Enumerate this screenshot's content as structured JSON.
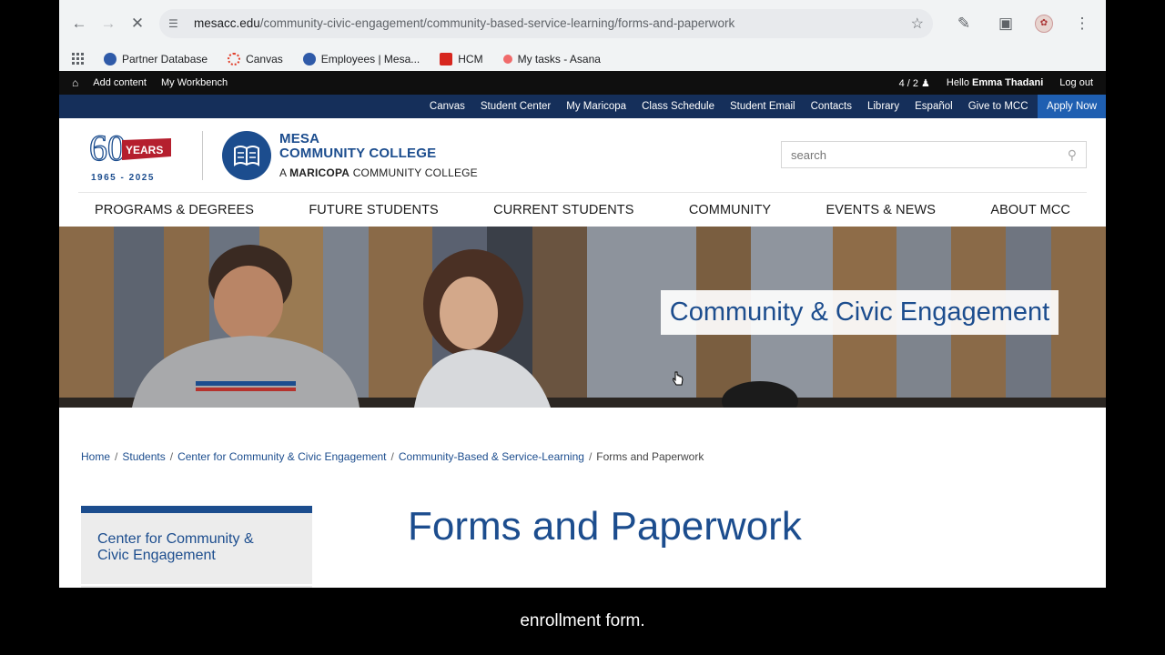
{
  "browser": {
    "url_domain": "mesacc.edu",
    "url_path": "/community-civic-engagement/community-based-service-learning/forms-and-paperwork"
  },
  "bookmarks": [
    {
      "label": "Partner Database",
      "color": "#2f5aa8"
    },
    {
      "label": "Canvas",
      "color": "#e13f2b"
    },
    {
      "label": "Employees | Mesa...",
      "color": "#2f5aa8"
    },
    {
      "label": "HCM",
      "color": "#d7261e"
    },
    {
      "label": "My tasks - Asana",
      "color": "#f06a6a"
    }
  ],
  "admin_bar": {
    "add_content": "Add content",
    "workbench": "My Workbench",
    "counter": "4 / 2",
    "hello": "Hello",
    "user_name": "Emma Thadani",
    "logout": "Log out"
  },
  "utility_nav": [
    "Canvas",
    "Student Center",
    "My Maricopa",
    "Class Schedule",
    "Student Email",
    "Contacts",
    "Library",
    "Español",
    "Give to MCC"
  ],
  "utility_apply": "Apply Now",
  "logo": {
    "sixty": "60",
    "years": "YEARS",
    "range": "1965 - 2025",
    "line1": "MESA",
    "line2": "COMMUNITY COLLEGE",
    "sub_prefix": "A",
    "sub_bold": "MARICOPA",
    "sub_rest": "COMMUNITY COLLEGE"
  },
  "search": {
    "placeholder": "search"
  },
  "main_nav": [
    "PROGRAMS & DEGREES",
    "FUTURE STUDENTS",
    "CURRENT STUDENTS",
    "COMMUNITY",
    "EVENTS & NEWS",
    "ABOUT MCC"
  ],
  "hero_title": "Community & Civic Engagement",
  "breadcrumb": {
    "links": [
      "Home",
      "Students",
      "Center for Community & Civic Engagement",
      "Community-Based & Service-Learning"
    ],
    "current": "Forms and Paperwork",
    "separator": "/"
  },
  "sidenav": {
    "title": "Center for Community & Civic Engagement"
  },
  "page_title": "Forms and Paperwork",
  "caption": "enrollment form.",
  "colors": {
    "brand_blue": "#1c4d8e",
    "utility_bg": "#152f5a",
    "apply_bg": "#1f5fb1",
    "admin_bg": "#0f0f0f"
  }
}
